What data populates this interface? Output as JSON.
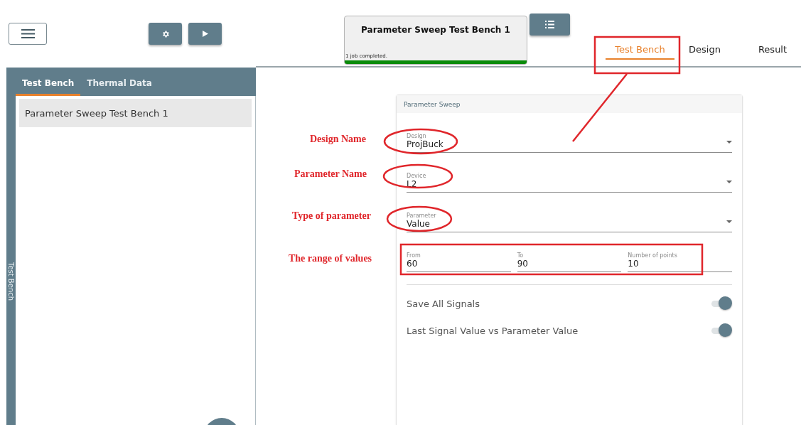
{
  "toolbar": {
    "buttons": [
      {
        "kind": "menu"
      },
      {
        "kind": "settings"
      },
      {
        "kind": "run"
      }
    ]
  },
  "sidebar": {
    "vertical_label": "Test Bench",
    "tabs": [
      {
        "label": "Test Bench",
        "selected": true
      },
      {
        "label": "Thermal Data",
        "selected": false
      }
    ],
    "items": [
      {
        "label": "Parameter Sweep Test Bench 1",
        "selected": true
      }
    ]
  },
  "job": {
    "title": "Parameter Sweep Test Bench 1",
    "status": "1 job completed.",
    "level": 1
  },
  "view_tabs": [
    {
      "label": "Test Bench",
      "selected": true
    },
    {
      "label": "Design",
      "selected": false
    },
    {
      "label": "Result",
      "selected": false
    }
  ],
  "parameter_sweep": {
    "title": "Parameter Sweep",
    "selects": [
      {
        "label": "Design",
        "value": "ProjBuck"
      },
      {
        "label": "Device",
        "value": "L2"
      },
      {
        "label": "Parameter",
        "value": "Value"
      }
    ],
    "range_fields": [
      {
        "label": "From",
        "value": "60"
      },
      {
        "label": "To",
        "value": "90"
      },
      {
        "label": "Number of points",
        "value": "10"
      }
    ],
    "toggles": [
      {
        "label": "Save All Signals",
        "on": true
      },
      {
        "label": "Last Signal Value vs Parameter Value",
        "on": true
      }
    ]
  },
  "annotations": [
    "Design Name",
    "Parameter Name",
    "Type of parameter",
    "The range of values"
  ]
}
